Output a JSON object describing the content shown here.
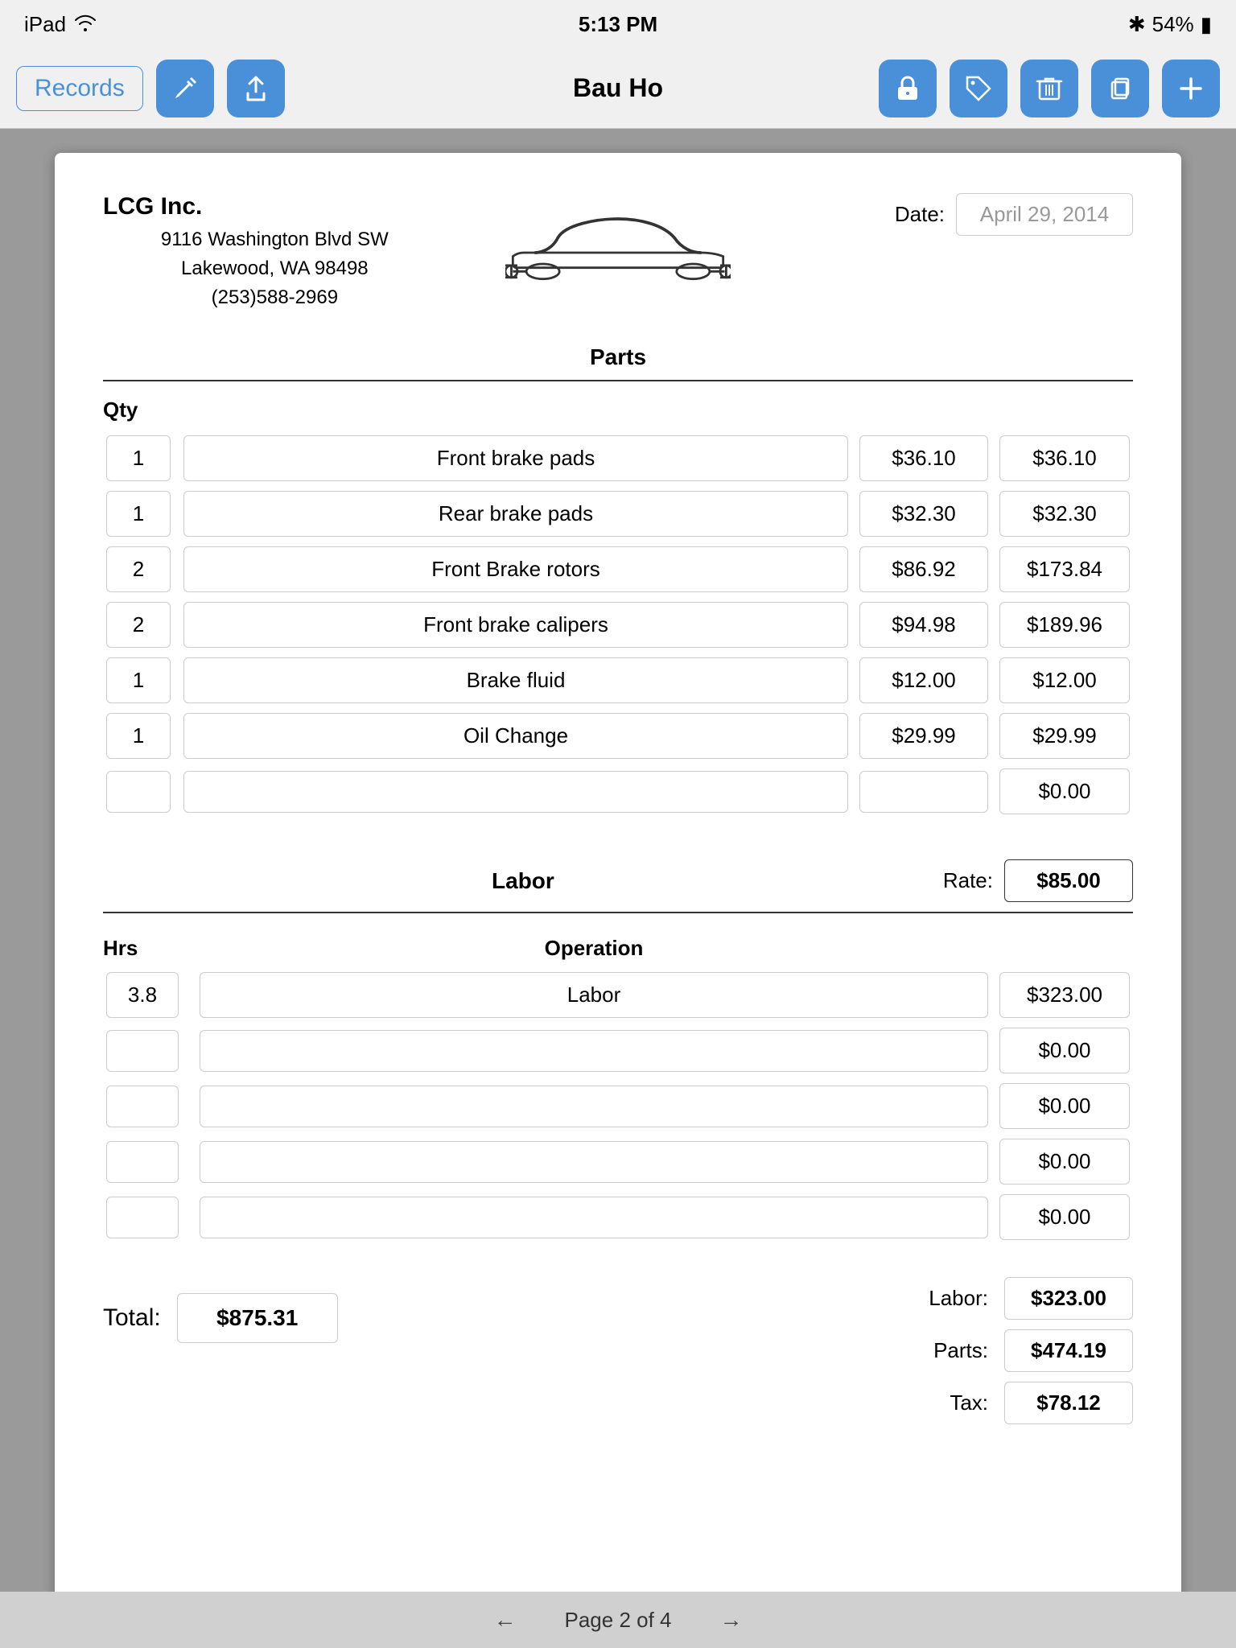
{
  "statusBar": {
    "device": "iPad",
    "time": "5:13 PM",
    "bluetooth": "54%"
  },
  "toolbar": {
    "records_label": "Records",
    "title": "Bau Ho"
  },
  "document": {
    "company": {
      "name": "LCG Inc.",
      "address_line1": "9116 Washington Blvd SW",
      "address_line2": "Lakewood, WA  98498",
      "phone": "(253)588-2969"
    },
    "date_label": "Date:",
    "date_value": "April 29, 2014",
    "parts_section": {
      "title": "Parts",
      "qty_header": "Qty",
      "rows": [
        {
          "qty": "1",
          "desc": "Front brake pads",
          "price": "$36.10",
          "total": "$36.10"
        },
        {
          "qty": "1",
          "desc": "Rear brake pads",
          "price": "$32.30",
          "total": "$32.30"
        },
        {
          "qty": "2",
          "desc": "Front Brake rotors",
          "price": "$86.92",
          "total": "$173.84"
        },
        {
          "qty": "2",
          "desc": "Front brake calipers",
          "price": "$94.98",
          "total": "$189.96"
        },
        {
          "qty": "1",
          "desc": "Brake fluid",
          "price": "$12.00",
          "total": "$12.00"
        },
        {
          "qty": "1",
          "desc": "Oil Change",
          "price": "$29.99",
          "total": "$29.99"
        },
        {
          "qty": "",
          "desc": "",
          "price": "",
          "total": "$0.00"
        }
      ]
    },
    "labor_section": {
      "title": "Labor",
      "rate_label": "Rate:",
      "rate_value": "$85.00",
      "hrs_header": "Hrs",
      "op_header": "Operation",
      "rows": [
        {
          "hrs": "3.8",
          "op": "Labor",
          "total": "$323.00"
        },
        {
          "hrs": "",
          "op": "",
          "total": "$0.00"
        },
        {
          "hrs": "",
          "op": "",
          "total": "$0.00"
        },
        {
          "hrs": "",
          "op": "",
          "total": "$0.00"
        },
        {
          "hrs": "",
          "op": "",
          "total": "$0.00"
        }
      ]
    },
    "summary": {
      "total_label": "Total:",
      "total_value": "$875.31",
      "labor_label": "Labor:",
      "labor_value": "$323.00",
      "parts_label": "Parts:",
      "parts_value": "$474.19",
      "tax_label": "Tax:",
      "tax_value": "$78.12"
    }
  },
  "pagination": {
    "page_text": "Page 2 of 4"
  }
}
